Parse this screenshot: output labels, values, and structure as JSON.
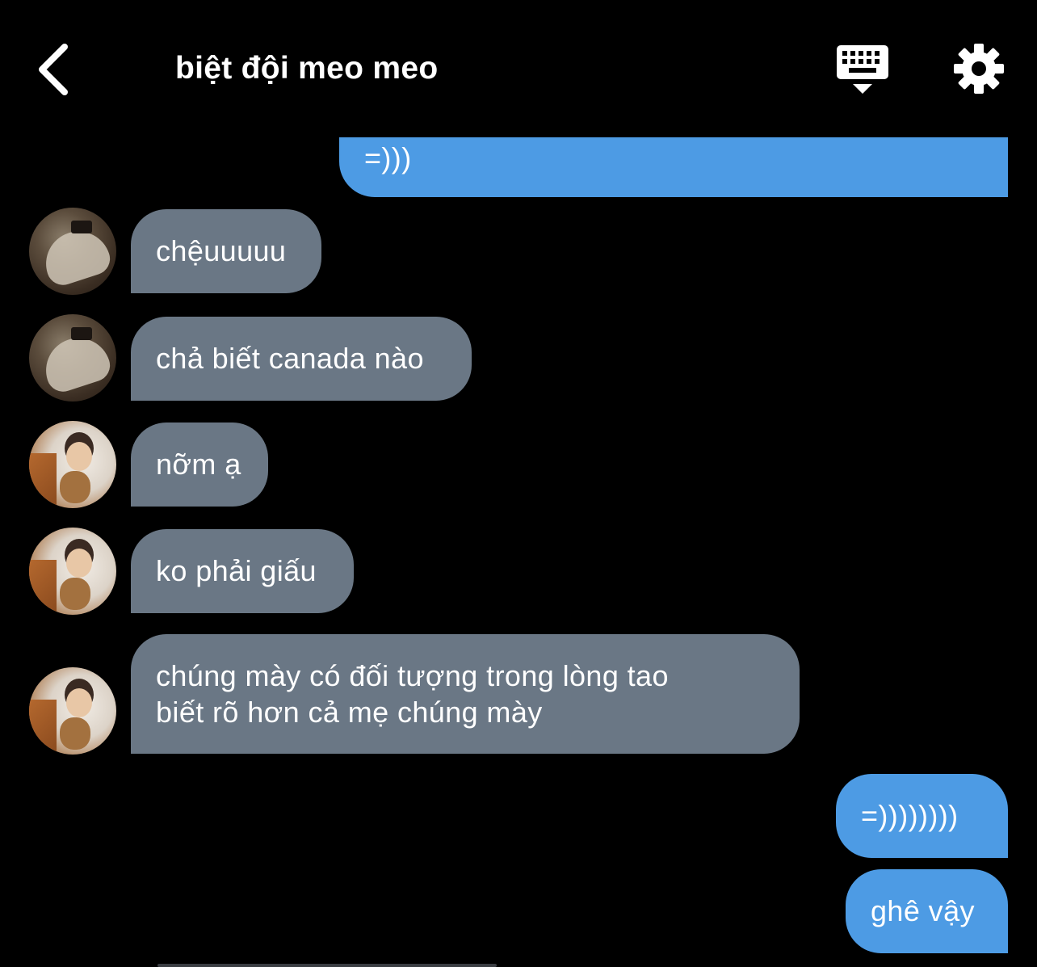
{
  "header": {
    "title": "biệt đội meo meo",
    "back_icon": "chevron-left-icon",
    "keyboard_icon": "keyboard-hide-icon",
    "settings_icon": "gear-icon"
  },
  "messages": [
    {
      "direction": "out",
      "text": "=)))"
    },
    {
      "direction": "in",
      "avatar": "user-a",
      "text": "chệuuuuu"
    },
    {
      "direction": "in",
      "avatar": "user-a",
      "text": "chả biết canada nào"
    },
    {
      "direction": "in",
      "avatar": "user-b",
      "text": "nỡm ạ"
    },
    {
      "direction": "in",
      "avatar": "user-b",
      "text": "ko phải giấu"
    },
    {
      "direction": "in",
      "avatar": "user-b",
      "lines": [
        "chúng mày có đối tượng trong lòng tao",
        "biết rõ hơn cả mẹ chúng mày"
      ]
    },
    {
      "direction": "out",
      "text": "=))))))))"
    },
    {
      "direction": "out",
      "text": "ghê vậy"
    }
  ],
  "colors": {
    "background": "#000000",
    "incoming_bubble": "#6a7785",
    "outgoing_bubble": "#4d9be4",
    "text": "#ffffff"
  }
}
